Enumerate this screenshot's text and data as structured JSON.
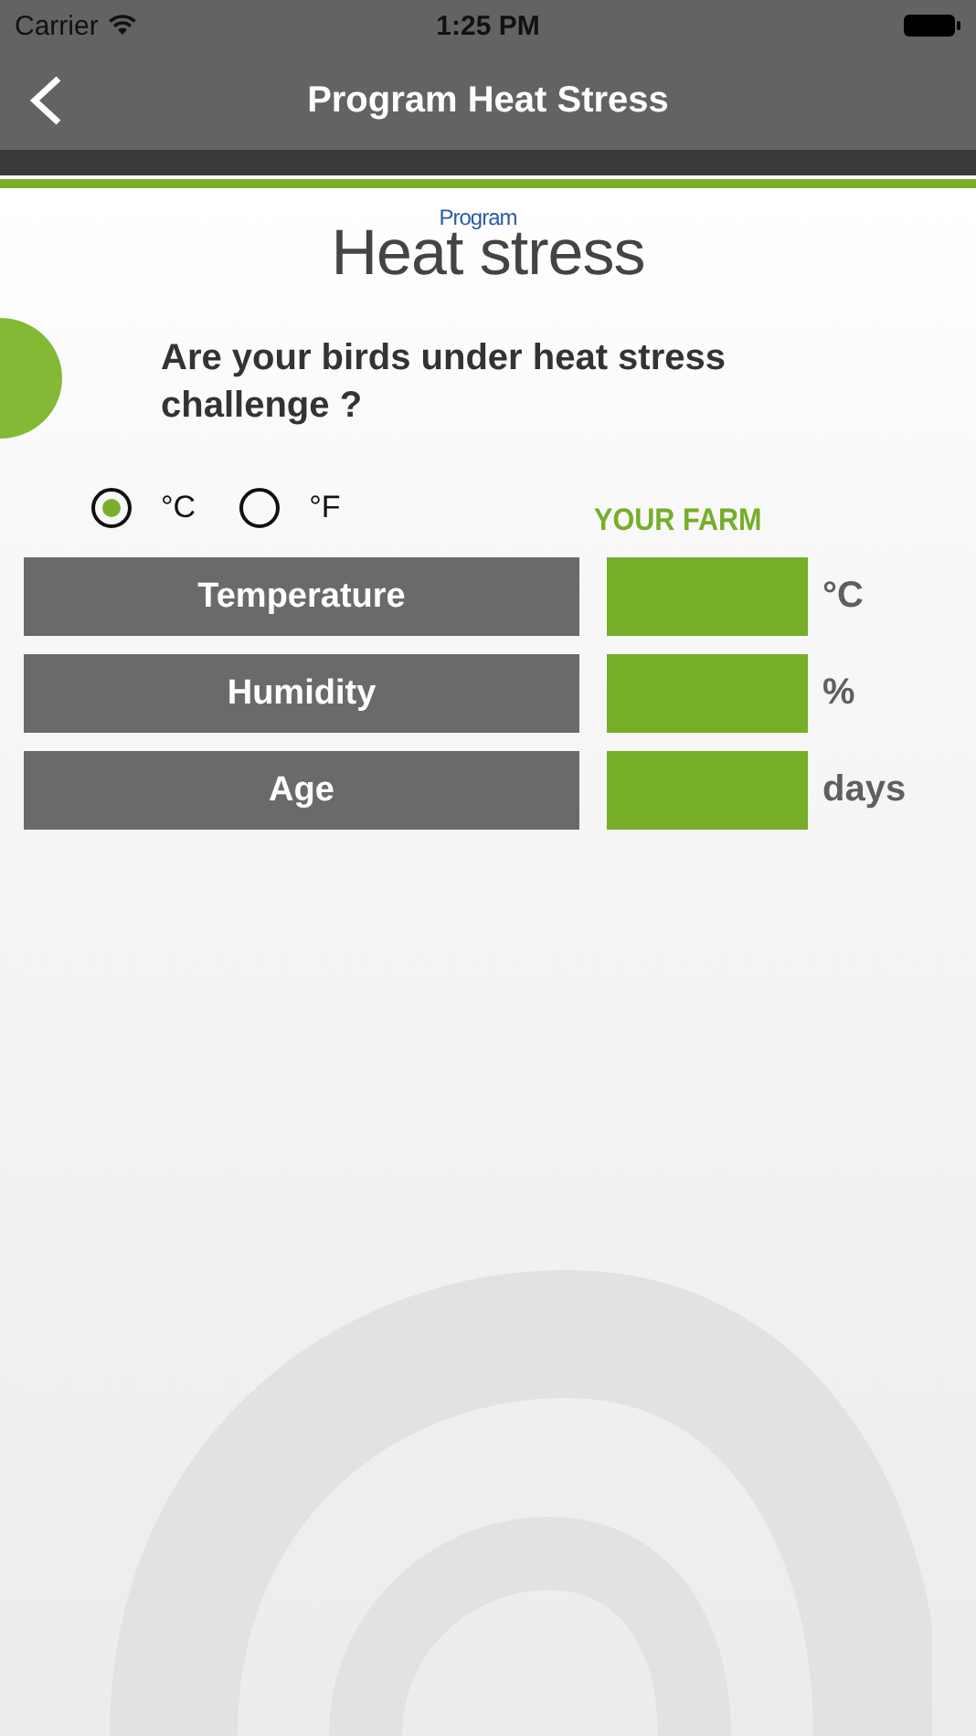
{
  "status_bar": {
    "carrier": "Carrier",
    "time": "1:25 PM"
  },
  "nav": {
    "title": "Program Heat Stress"
  },
  "logo": {
    "superscript": "Program",
    "title": "Heat stress"
  },
  "question": "Are your birds under heat stress challenge ?",
  "unit_options": [
    {
      "label": "°C",
      "selected": true
    },
    {
      "label": "°F",
      "selected": false
    }
  ],
  "column_header": "YOUR FARM",
  "inputs": [
    {
      "label": "Temperature",
      "unit": "°C"
    },
    {
      "label": "Humidity",
      "unit": "%"
    },
    {
      "label": "Age",
      "unit": "days"
    }
  ]
}
